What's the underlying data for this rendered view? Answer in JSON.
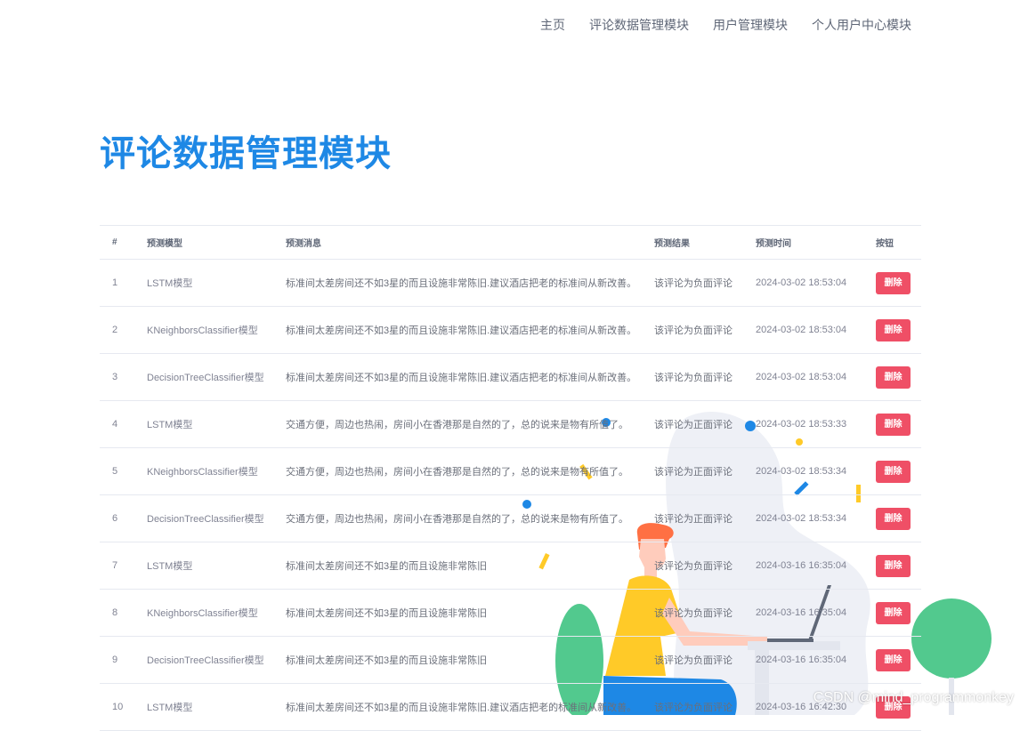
{
  "nav": {
    "items": [
      "主页",
      "评论数据管理模块",
      "用户管理模块",
      "个人用户中心模块"
    ]
  },
  "page": {
    "title": "评论数据管理模块"
  },
  "table": {
    "headers": [
      "#",
      "预测模型",
      "预测消息",
      "预测结果",
      "预测时间",
      "按钮"
    ],
    "delete_label": "删除",
    "rows": [
      {
        "id": "1",
        "model": "LSTM模型",
        "message": "标准间太差房间还不如3星的而且设施非常陈旧.建议酒店把老的标准间从新改善。",
        "result": "该评论为负面评论",
        "time": "2024-03-02 18:53:04"
      },
      {
        "id": "2",
        "model": "KNeighborsClassifier模型",
        "message": "标准间太差房间还不如3星的而且设施非常陈旧.建议酒店把老的标准间从新改善。",
        "result": "该评论为负面评论",
        "time": "2024-03-02 18:53:04"
      },
      {
        "id": "3",
        "model": "DecisionTreeClassifier模型",
        "message": "标准间太差房间还不如3星的而且设施非常陈旧.建议酒店把老的标准间从新改善。",
        "result": "该评论为负面评论",
        "time": "2024-03-02 18:53:04"
      },
      {
        "id": "4",
        "model": "LSTM模型",
        "message": "交通方便，周边也热闹，房间小在香港那是自然的了，总的说来是物有所值了。",
        "result": "该评论为正面评论",
        "time": "2024-03-02 18:53:33"
      },
      {
        "id": "5",
        "model": "KNeighborsClassifier模型",
        "message": "交通方便，周边也热闹，房间小在香港那是自然的了，总的说来是物有所值了。",
        "result": "该评论为正面评论",
        "time": "2024-03-02 18:53:34"
      },
      {
        "id": "6",
        "model": "DecisionTreeClassifier模型",
        "message": "交通方便，周边也热闹，房间小在香港那是自然的了，总的说来是物有所值了。",
        "result": "该评论为正面评论",
        "time": "2024-03-02 18:53:34"
      },
      {
        "id": "7",
        "model": "LSTM模型",
        "message": "标准间太差房间还不如3星的而且设施非常陈旧",
        "result": "该评论为负面评论",
        "time": "2024-03-16 16:35:04"
      },
      {
        "id": "8",
        "model": "KNeighborsClassifier模型",
        "message": "标准间太差房间还不如3星的而且设施非常陈旧",
        "result": "该评论为负面评论",
        "time": "2024-03-16 16:35:04"
      },
      {
        "id": "9",
        "model": "DecisionTreeClassifier模型",
        "message": "标准间太差房间还不如3星的而且设施非常陈旧",
        "result": "该评论为负面评论",
        "time": "2024-03-16 16:35:04"
      },
      {
        "id": "10",
        "model": "LSTM模型",
        "message": "标准间太差房间还不如3星的而且设施非常陈旧.建议酒店把老的标准间从新改善。",
        "result": "该评论为负面评论",
        "time": "2024-03-16 16:42:30"
      }
    ]
  },
  "watermark": "CSDN @mind_programmonkey",
  "colors": {
    "title": "#1e88e5",
    "delete_button": "#ef4f66",
    "illustration_green": "#52c98e",
    "illustration_yellow": "#ffca28",
    "illustration_blue": "#1e88e5"
  }
}
